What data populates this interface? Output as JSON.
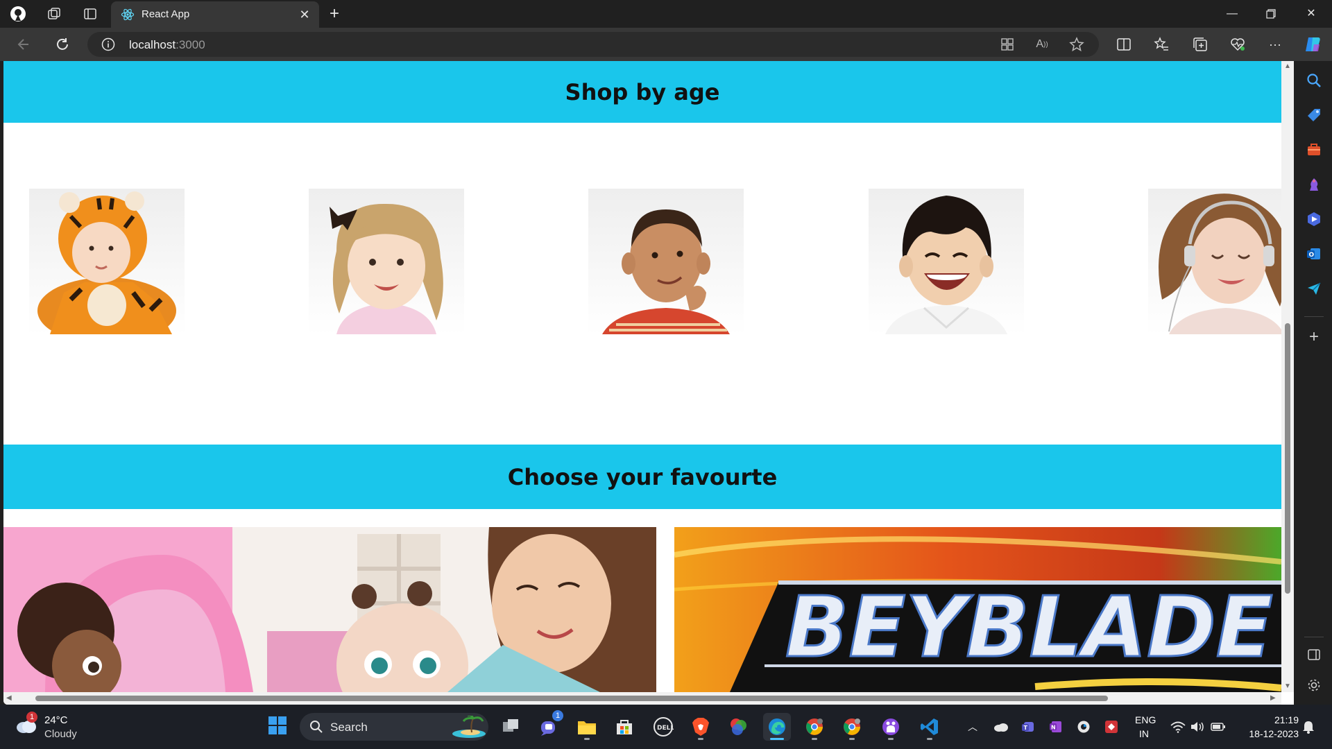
{
  "browser": {
    "tab_title": "React App",
    "url_host": "localhost",
    "url_port": ":3000"
  },
  "page": {
    "shop_by_age_heading": "Shop by age",
    "favourite_heading": "Choose your favourte",
    "age_images": [
      "baby in tiger costume",
      "toddler girl with bow",
      "thinking boy",
      "smiling boy",
      "girl with headphones"
    ],
    "favourite_images": [
      "baby doll and girl",
      "Beyblade banner"
    ],
    "beyblade_logo": "BEYBLADE"
  },
  "taskbar": {
    "weather_temp": "24°C",
    "weather_desc": "Cloudy",
    "weather_badge": "1",
    "search_label": "Search",
    "chat_badge": "1",
    "lang_line1": "ENG",
    "lang_line2": "IN",
    "time": "21:19",
    "date": "18-12-2023"
  },
  "colors": {
    "banner": "#1ac6eb",
    "taskbar": "#1c1f26",
    "browser_chrome": "#202020"
  }
}
